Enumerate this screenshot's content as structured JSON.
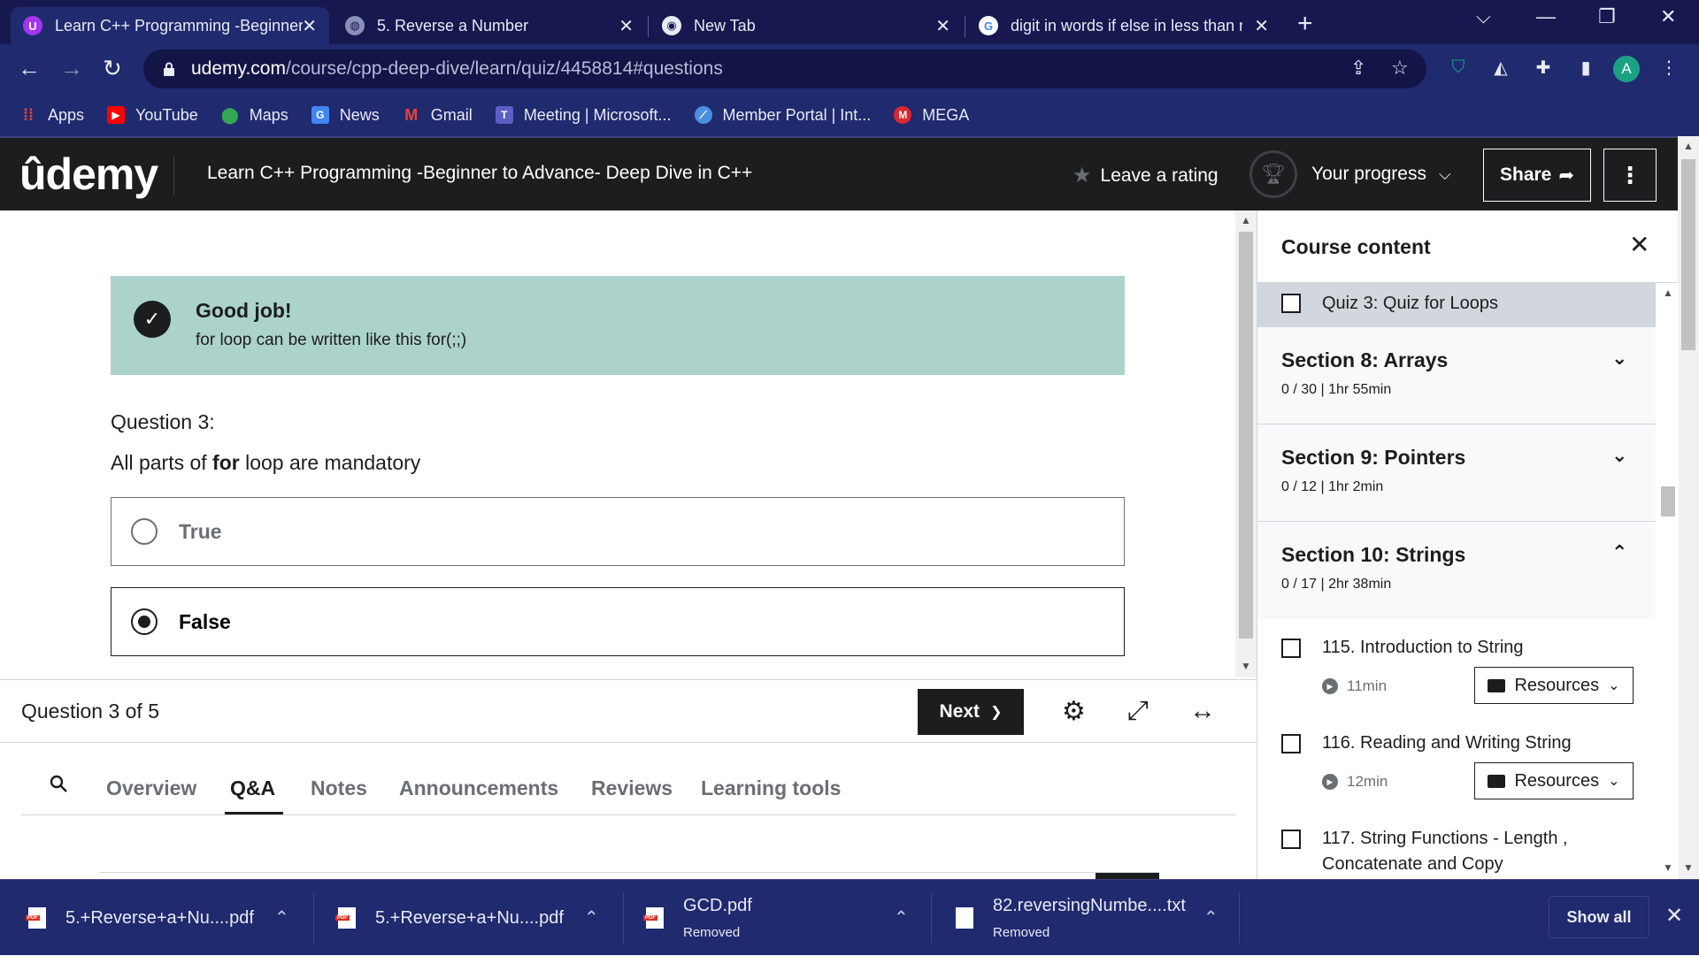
{
  "browser": {
    "tabs": [
      {
        "title": "Learn C++ Programming -Beginner to Advance- Deep Dive in C++",
        "icon": "udemy-icon",
        "active": true
      },
      {
        "title": "5. Reverse a Number",
        "icon": "globe-icon",
        "active": false
      },
      {
        "title": "New Tab",
        "icon": "chrome-icon",
        "active": false
      },
      {
        "title": "digit in words if else in less than n",
        "icon": "google-icon",
        "active": false
      }
    ],
    "url_host": "udemy.com",
    "url_path": "/course/cpp-deep-dive/learn/quiz/4458814#questions",
    "avatar_letter": "A",
    "bookmarks": [
      {
        "label": "Apps",
        "icon": "apps-grid-icon",
        "color": "#ea4335"
      },
      {
        "label": "YouTube",
        "icon": "youtube-icon",
        "color": "#ff0000"
      },
      {
        "label": "Maps",
        "icon": "maps-icon",
        "color": "#34a853"
      },
      {
        "label": "News",
        "icon": "news-icon",
        "color": "#4285f4"
      },
      {
        "label": "Gmail",
        "icon": "gmail-icon",
        "color": "#ea4335"
      },
      {
        "label": "Meeting | Microsoft...",
        "icon": "teams-icon",
        "color": "#5b5fc7"
      },
      {
        "label": "Member Portal | Int...",
        "icon": "portal-icon",
        "color": "#4a90e2"
      },
      {
        "label": "MEGA",
        "icon": "mega-icon",
        "color": "#d9272e"
      }
    ]
  },
  "header": {
    "logo": "ûdemy",
    "course_title": "Learn C++ Programming -Beginner to Advance- Deep Dive in C++",
    "leave_rating": "Leave a rating",
    "your_progress": "Your progress",
    "share": "Share"
  },
  "quiz": {
    "feedback_title": "Good job!",
    "feedback_text": "for loop can be written like this for(;;)",
    "question_number": "Question 3:",
    "question_pre": "All parts of ",
    "question_bold": "for",
    "question_post": " loop are mandatory",
    "options": [
      {
        "label": "True",
        "selected": false
      },
      {
        "label": "False",
        "selected": true
      }
    ],
    "counter": "Question 3 of 5",
    "next_label": "Next"
  },
  "tabs": [
    "Overview",
    "Q&A",
    "Notes",
    "Announcements",
    "Reviews",
    "Learning tools"
  ],
  "active_tab": "Q&A",
  "sidebar": {
    "title": "Course content",
    "quiz_item": "Quiz 3: Quiz for Loops",
    "sections": [
      {
        "title": "Section 8: Arrays",
        "meta": "0 / 30 | 1hr 55min",
        "expanded": false
      },
      {
        "title": "Section 9: Pointers",
        "meta": "0 / 12 | 1hr 2min",
        "expanded": false
      },
      {
        "title": "Section 10: Strings",
        "meta": "0 / 17 | 2hr 38min",
        "expanded": true
      }
    ],
    "lectures": [
      {
        "title": "115. Introduction to String",
        "duration": "11min",
        "resources": "Resources"
      },
      {
        "title": "116. Reading and Writing String",
        "duration": "12min",
        "resources": "Resources"
      },
      {
        "title": "117. String Functions - Length , Concatenate and Copy"
      }
    ]
  },
  "downloads": {
    "items": [
      {
        "name": "5.+Reverse+a+Nu....pdf",
        "state": "",
        "type": "pdf"
      },
      {
        "name": "5.+Reverse+a+Nu....pdf",
        "state": "",
        "type": "pdf"
      },
      {
        "name": "GCD.pdf",
        "state": "Removed",
        "type": "pdf"
      },
      {
        "name": "82.reversingNumbe....txt",
        "state": "Removed",
        "type": "txt"
      }
    ],
    "show_all": "Show all"
  }
}
